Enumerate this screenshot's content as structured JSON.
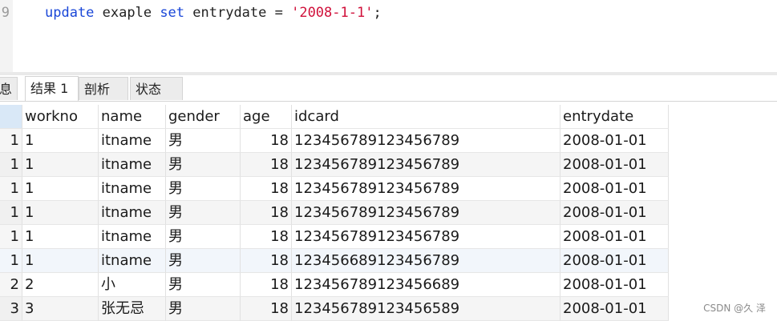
{
  "editor": {
    "line_number": "9",
    "prev_line_fragment": "update exaple set entrydate = '2008-1-1';",
    "tokens": {
      "kw_update": "update",
      "table": " exaple ",
      "kw_set": "set",
      "assign": " entrydate = ",
      "value": "'2008-1-1'",
      "end": ";"
    }
  },
  "tabs": [
    {
      "label": "息"
    },
    {
      "label": "结果 1"
    },
    {
      "label": "剖析"
    },
    {
      "label": "状态"
    }
  ],
  "grid": {
    "columns": [
      "workno",
      "name",
      "gender",
      "age",
      "idcard",
      "entrydate"
    ],
    "rows": [
      {
        "idx": "1",
        "workno": "1",
        "name": "itname",
        "gender": "男",
        "age": "18",
        "idcard": "123456789123456789",
        "entrydate": "2008-01-01"
      },
      {
        "idx": "1",
        "workno": "1",
        "name": "itname",
        "gender": "男",
        "age": "18",
        "idcard": "123456789123456789",
        "entrydate": "2008-01-01"
      },
      {
        "idx": "1",
        "workno": "1",
        "name": "itname",
        "gender": "男",
        "age": "18",
        "idcard": "123456789123456789",
        "entrydate": "2008-01-01"
      },
      {
        "idx": "1",
        "workno": "1",
        "name": "itname",
        "gender": "男",
        "age": "18",
        "idcard": "123456789123456789",
        "entrydate": "2008-01-01"
      },
      {
        "idx": "1",
        "workno": "1",
        "name": "itname",
        "gender": "男",
        "age": "18",
        "idcard": "123456789123456789",
        "entrydate": "2008-01-01"
      },
      {
        "idx": "1",
        "workno": "1",
        "name": "itname",
        "gender": "男",
        "age": "18",
        "idcard": "123456689123456789",
        "entrydate": "2008-01-01"
      },
      {
        "idx": "2",
        "workno": "2",
        "name": "小",
        "gender": "男",
        "age": "18",
        "idcard": "123456789123456689",
        "entrydate": "2008-01-01"
      },
      {
        "idx": "3",
        "workno": "3",
        "name": "张无忌",
        "gender": "男",
        "age": "18",
        "idcard": "123456789123456589",
        "entrydate": "2008-01-01"
      }
    ]
  },
  "watermark": "CSDN @久 泽"
}
